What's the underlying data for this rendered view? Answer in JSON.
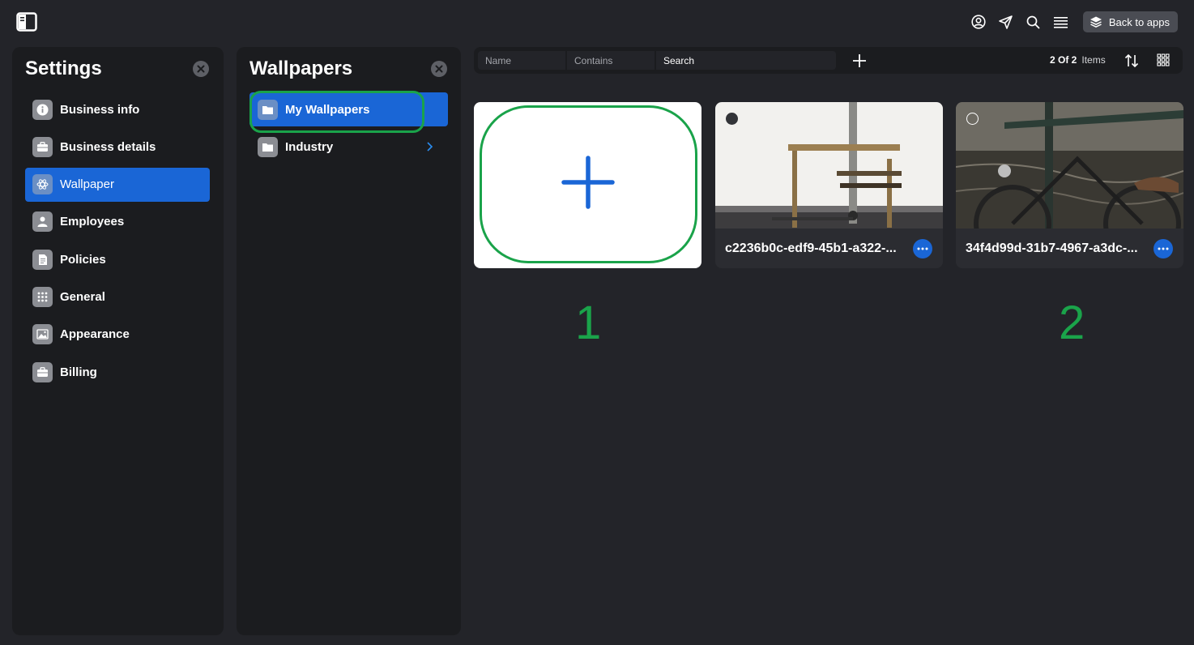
{
  "topbar": {
    "back_label": "Back to apps",
    "icons": [
      "sidebar-toggle-icon",
      "account-icon",
      "send-icon",
      "search-icon",
      "menu-icon",
      "layers-icon"
    ]
  },
  "settings": {
    "title": "Settings",
    "items": [
      {
        "label": "Business info",
        "icon": "info-icon",
        "active": false
      },
      {
        "label": "Business details",
        "icon": "briefcase-icon",
        "active": false
      },
      {
        "label": "Wallpaper",
        "icon": "flower-icon",
        "active": true
      },
      {
        "label": "Employees",
        "icon": "person-icon",
        "active": false
      },
      {
        "label": "Policies",
        "icon": "document-icon",
        "active": false
      },
      {
        "label": "General",
        "icon": "grid-dots-icon",
        "active": false
      },
      {
        "label": "Appearance",
        "icon": "image-icon",
        "active": false
      },
      {
        "label": "Billing",
        "icon": "briefcase-icon",
        "active": false
      }
    ]
  },
  "wallpapers": {
    "title": "Wallpapers",
    "folders": [
      {
        "label": "My Wallpapers",
        "active": true
      },
      {
        "label": "Industry",
        "active": false
      }
    ]
  },
  "filterbar": {
    "name_placeholder": "Name",
    "contains_placeholder": "Contains",
    "search_placeholder": "Search",
    "count": "2 Of 2",
    "count_label": "Items"
  },
  "cards": [
    {
      "name": "c2236b0c-edf9-45b1-a322-...",
      "selected": true
    },
    {
      "name": "34f4d99d-31b7-4967-a3dc-...",
      "selected": false
    }
  ],
  "markers": [
    "1",
    "2"
  ],
  "colors": {
    "background": "#232429",
    "panel": "#1b1c1f",
    "accent": "#1a66d6",
    "highlight": "#1aa34a"
  }
}
